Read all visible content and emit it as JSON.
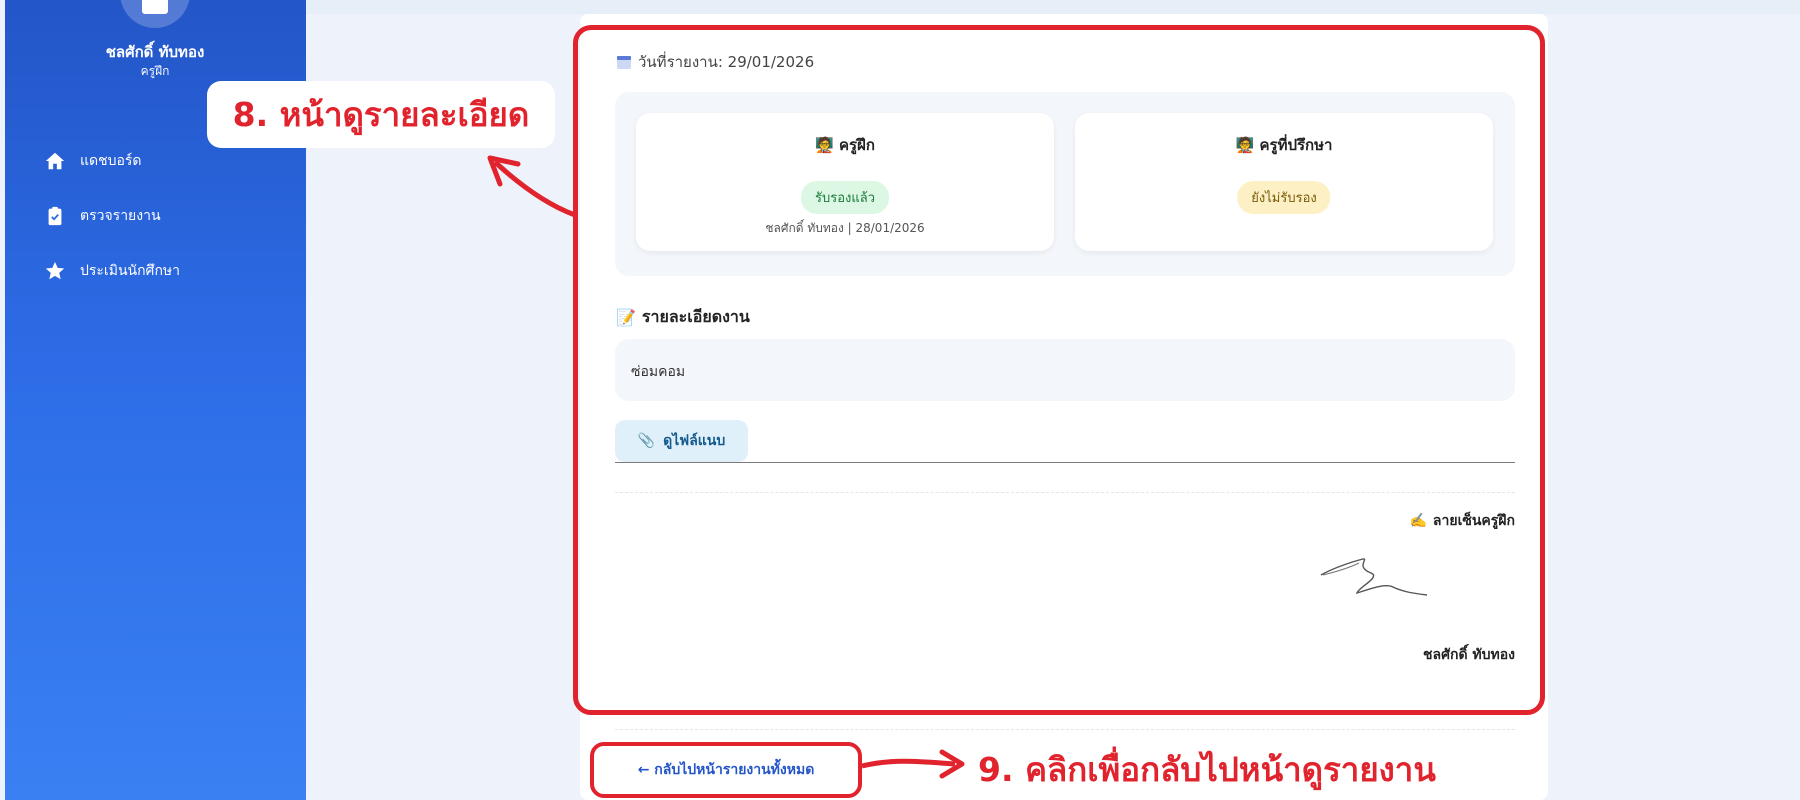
{
  "sidebar": {
    "user_name": "ชลศักดิ์ ทับทอง",
    "user_role": "ครูฝึก",
    "items": [
      {
        "label": "แดชบอร์ด",
        "icon": "home-icon"
      },
      {
        "label": "ตรวจรายงาน",
        "icon": "clipboard-check-icon"
      },
      {
        "label": "ประเมินนักศึกษา",
        "icon": "star-icon"
      }
    ]
  },
  "report": {
    "date_label": "วันที่รายงาน: 29/01/2026",
    "approvals": [
      {
        "title": "ครูฝึก",
        "status": "รับรองแล้ว",
        "meta": "ชลศักดิ์ ทับทอง | 28/01/2026"
      },
      {
        "title": "ครูที่ปรึกษา",
        "status": "ยังไม่รับรอง",
        "meta": ""
      }
    ],
    "detail_title": "รายละเอียดงาน",
    "detail_text": "ซ่อมคอม",
    "file_button": "ดูไฟล์แนบ",
    "signature_label": "ลายเซ็นครูฝึก",
    "signature_name": "ชลศักดิ์ ทับทอง",
    "back_link": "← กลับไปหน้ารายงานทั้งหมด"
  },
  "annotations": {
    "step8": "8. หน้าดูรายละเอียด",
    "step9": "9. คลิกเพื่อกลับไปหน้าดูรายงาน",
    "color": "#e0232c"
  },
  "colors": {
    "sidebar_top": "#2356c8",
    "sidebar_bottom": "#3a80f3",
    "approved_bg": "#dcf7e3",
    "pending_bg": "#fcf0c4",
    "link": "#2455c9"
  }
}
